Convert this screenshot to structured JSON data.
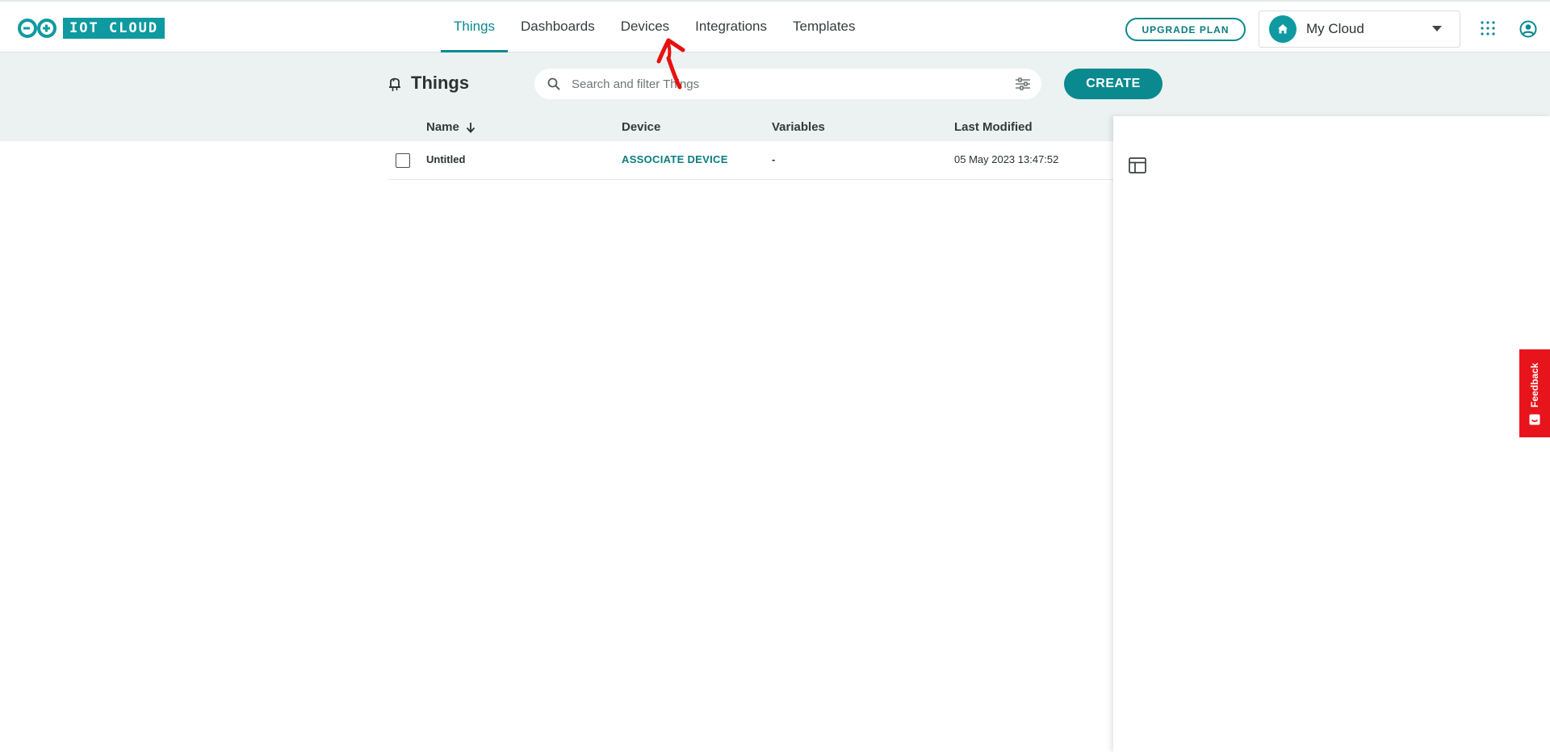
{
  "header": {
    "logo_text": "IOT CLOUD",
    "tabs": [
      {
        "label": "Things",
        "active": true
      },
      {
        "label": "Dashboards",
        "active": false
      },
      {
        "label": "Devices",
        "active": false
      },
      {
        "label": "Integrations",
        "active": false
      },
      {
        "label": "Templates",
        "active": false
      }
    ],
    "upgrade_label": "UPGRADE PLAN",
    "cloud_selector": {
      "value": "My Cloud"
    }
  },
  "things": {
    "title": "Things",
    "search_placeholder": "Search and filter Things",
    "create_label": "CREATE",
    "columns": {
      "name": "Name",
      "device": "Device",
      "variables": "Variables",
      "last_modified": "Last Modified"
    },
    "rows": [
      {
        "name": "Untitled",
        "device": "ASSOCIATE DEVICE",
        "variables": "-",
        "last_modified": "05 May 2023 13:47:52"
      }
    ]
  },
  "feedback": {
    "label": "Feedback"
  },
  "icons": {
    "logo": "arduino-infinity-icon",
    "home": "home-icon",
    "dropdown": "caret-down-icon",
    "apps": "apps-grid-icon",
    "user": "user-account-icon",
    "things": "lightbulb-icon",
    "search": "search-icon",
    "filter": "filter-sliders-icon",
    "sort": "arrow-down-icon",
    "table_settings": "table-layout-icon"
  },
  "colors": {
    "brand_teal": "#0a8a8f",
    "logo_teal": "#0e9aa0",
    "subheader_bg": "#ecf1f1",
    "feedback_red": "#e8141c",
    "annotation_red": "#e81010"
  }
}
